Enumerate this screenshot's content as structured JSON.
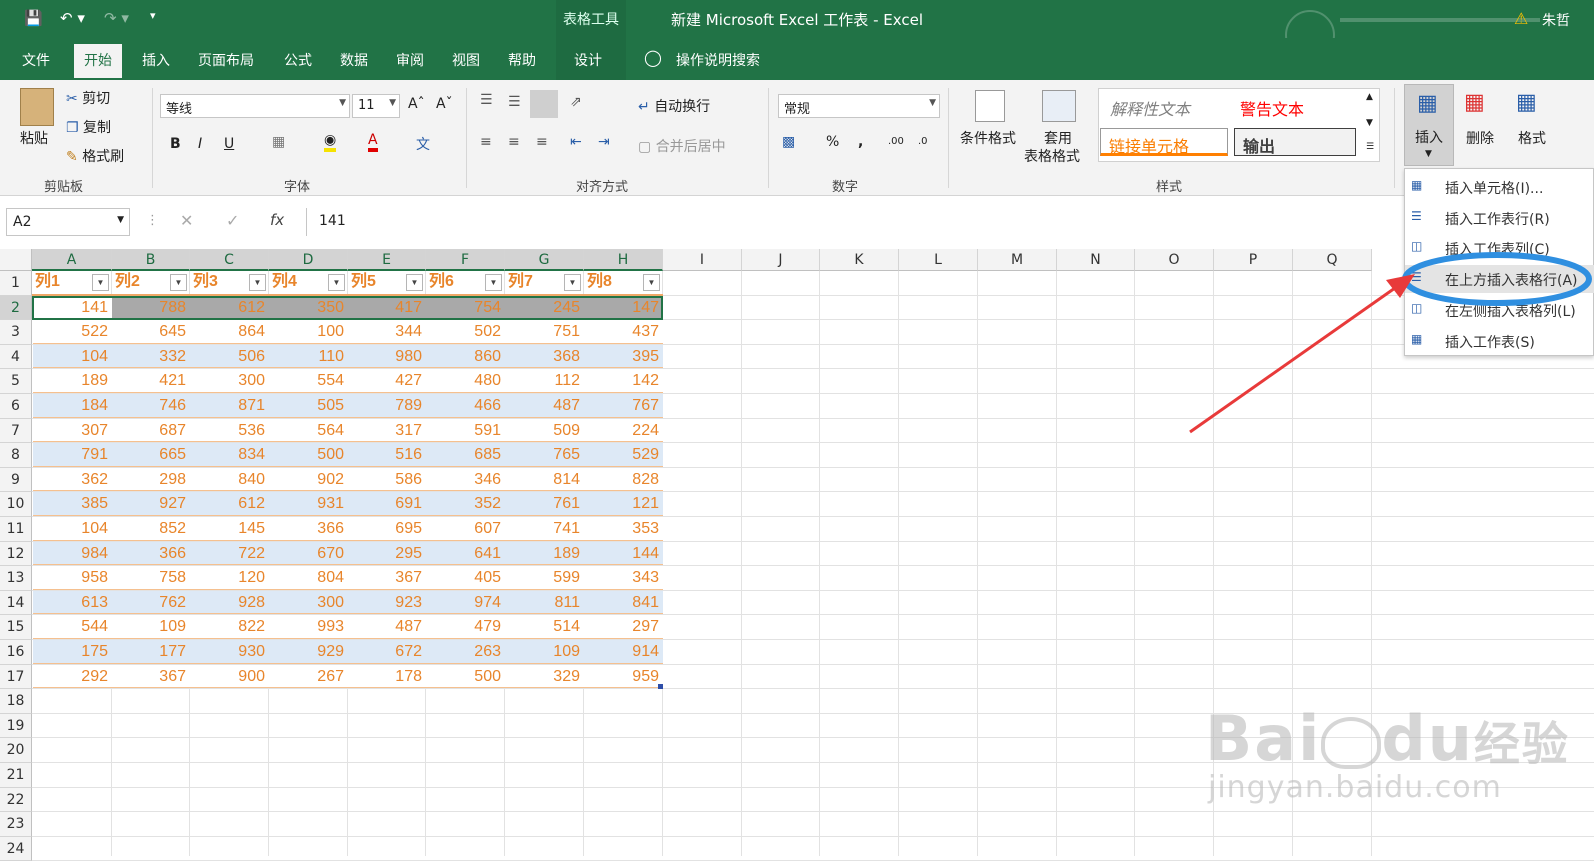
{
  "window": {
    "title": "新建 Microsoft Excel 工作表  -  Excel",
    "context_tab": "表格工具",
    "user": "朱哲"
  },
  "tabs": [
    "文件",
    "开始",
    "插入",
    "页面布局",
    "公式",
    "数据",
    "审阅",
    "视图",
    "帮助",
    "设计"
  ],
  "tell_me": "操作说明搜索",
  "clipboard": {
    "paste": "粘贴",
    "cut": "剪切",
    "copy": "复制",
    "format_painter": "格式刷",
    "group": "剪贴板"
  },
  "font": {
    "name": "等线",
    "size": "11",
    "group": "字体"
  },
  "alignment": {
    "wrap": "自动换行",
    "merge": "合并后居中",
    "group": "对齐方式"
  },
  "number": {
    "format": "常规",
    "group": "数字"
  },
  "styles": {
    "cond": "条件格式",
    "table1": "套用",
    "table2": "表格格式",
    "s1": "解释性文本",
    "s2": "警告文本",
    "s3": "链接单元格",
    "s4": "输出",
    "group": "样式"
  },
  "cells": {
    "insert": "插入",
    "delete": "删除",
    "format": "格式"
  },
  "formula_bar": {
    "name_box": "A2",
    "value": "141",
    "fx": "fx"
  },
  "insert_menu": [
    "插入单元格(I)...",
    "插入工作表行(R)",
    "插入工作表列(C)",
    "在上方插入表格行(A)",
    "在左侧插入表格列(L)",
    "插入工作表(S)"
  ],
  "columns": [
    "A",
    "B",
    "C",
    "D",
    "E",
    "F",
    "G",
    "H",
    "I",
    "J",
    "K",
    "L",
    "M",
    "N",
    "O",
    "P",
    "Q"
  ],
  "rows": [
    "1",
    "2",
    "3",
    "4",
    "5",
    "6",
    "7",
    "8",
    "9",
    "10",
    "11",
    "12",
    "13",
    "14",
    "15",
    "16",
    "17",
    "18",
    "19",
    "20",
    "21",
    "22",
    "23",
    "24"
  ],
  "table": {
    "headers": [
      "列1",
      "列2",
      "列3",
      "列4",
      "列5",
      "列6",
      "列7",
      "列8"
    ],
    "data": [
      [
        "141",
        "788",
        "612",
        "350",
        "417",
        "754",
        "245",
        "147"
      ],
      [
        "522",
        "645",
        "864",
        "100",
        "344",
        "502",
        "751",
        "437"
      ],
      [
        "104",
        "332",
        "506",
        "110",
        "980",
        "860",
        "368",
        "395"
      ],
      [
        "189",
        "421",
        "300",
        "554",
        "427",
        "480",
        "112",
        "142"
      ],
      [
        "184",
        "746",
        "871",
        "505",
        "789",
        "466",
        "487",
        "767"
      ],
      [
        "307",
        "687",
        "536",
        "564",
        "317",
        "591",
        "509",
        "224"
      ],
      [
        "791",
        "665",
        "834",
        "500",
        "516",
        "685",
        "765",
        "529"
      ],
      [
        "362",
        "298",
        "840",
        "902",
        "586",
        "346",
        "814",
        "828"
      ],
      [
        "385",
        "927",
        "612",
        "931",
        "691",
        "352",
        "761",
        "121"
      ],
      [
        "104",
        "852",
        "145",
        "366",
        "695",
        "607",
        "741",
        "353"
      ],
      [
        "984",
        "366",
        "722",
        "670",
        "295",
        "641",
        "189",
        "144"
      ],
      [
        "958",
        "758",
        "120",
        "804",
        "367",
        "405",
        "599",
        "343"
      ],
      [
        "613",
        "762",
        "928",
        "300",
        "923",
        "974",
        "811",
        "841"
      ],
      [
        "544",
        "109",
        "822",
        "993",
        "487",
        "479",
        "514",
        "297"
      ],
      [
        "175",
        "177",
        "930",
        "929",
        "672",
        "263",
        "109",
        "914"
      ],
      [
        "292",
        "367",
        "900",
        "267",
        "178",
        "500",
        "329",
        "959"
      ]
    ]
  },
  "watermark": {
    "brand": "Bai",
    "brand2": "du",
    "brand3": "经验",
    "url": "jingyan.baidu.com"
  },
  "colors": {
    "excel_green": "#217346",
    "accent_orange": "#e8852b",
    "band_blue": "#dde9f6",
    "annot_blue": "#2f8fe0",
    "arrow_red": "#e83a3a"
  }
}
